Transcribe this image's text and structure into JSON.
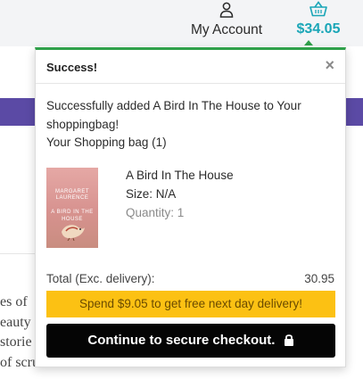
{
  "header": {
    "account_label": "My Account",
    "account_icon": "user-icon",
    "cart_icon": "basket-icon",
    "cart_total": "$34.05"
  },
  "background": {
    "text_lines": [
      "es of",
      "eauty",
      "storie",
      "of scrub-"
    ]
  },
  "popup": {
    "title": "Success!",
    "close_label": "×",
    "message": "Successfully added A Bird In The House to Your shoppingbag!",
    "bag_count": "Your Shopping bag (1)",
    "item": {
      "cover_author": "MARGARET LAURENCE",
      "cover_title": "A BIRD IN THE HOUSE",
      "title": "A Bird In The House",
      "size": "Size: N/A",
      "quantity": "Quantity: 1"
    },
    "total_label": "Total (Exc. delivery):",
    "total_value": "30.95",
    "free_delivery_banner": "Spend $9.05 to get free next day delivery!",
    "checkout_label": "Continue to secure checkout."
  },
  "colors": {
    "accent_teal": "#1aa6b7",
    "success_green": "#2fa04a",
    "banner_yellow": "#fcc113",
    "band_purple": "#5b4aa5"
  }
}
